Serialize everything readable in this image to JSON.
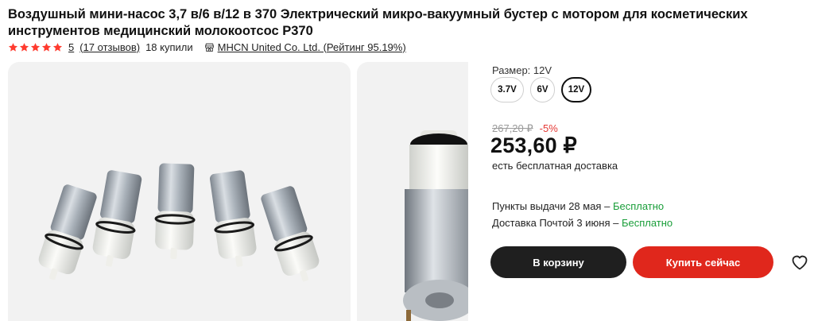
{
  "product": {
    "title_line1": "Воздушный мини-насос 3,7 в/6 в/12 в 370 Электрический микро-вакуумный бустер с мотором для косметических",
    "title_line2": "инструментов медицинский молокоотсос P370",
    "rating": "5",
    "reviews": "(17 отзывов)",
    "bought": "18 купили",
    "store": "MHCN United Co. Ltd. (Рейтинг 95.19%)",
    "star_count": 5,
    "star_color": "#ff3b2f"
  },
  "options": {
    "size_label": "Размер: 12V",
    "sizes": [
      "3.7V",
      "6V",
      "12V"
    ],
    "selected": "12V"
  },
  "pricing": {
    "old_price": "267,20 ₽",
    "discount": "-5%",
    "price": "253,60 ₽",
    "shipping_note": "есть бесплатная доставка"
  },
  "delivery": {
    "pickup_text": "Пункты выдачи 28 мая – ",
    "pickup_cost": "Бесплатно",
    "post_text": "Доставка Почтой 3 июня – ",
    "post_cost": "Бесплатно"
  },
  "actions": {
    "cart": "В корзину",
    "buy": "Купить сейчас",
    "cart_color": "#1f1f1f",
    "buy_color": "#e0271c"
  },
  "icons": {
    "star": "star-icon",
    "store": "store-icon",
    "wishlist": "heart-icon"
  }
}
